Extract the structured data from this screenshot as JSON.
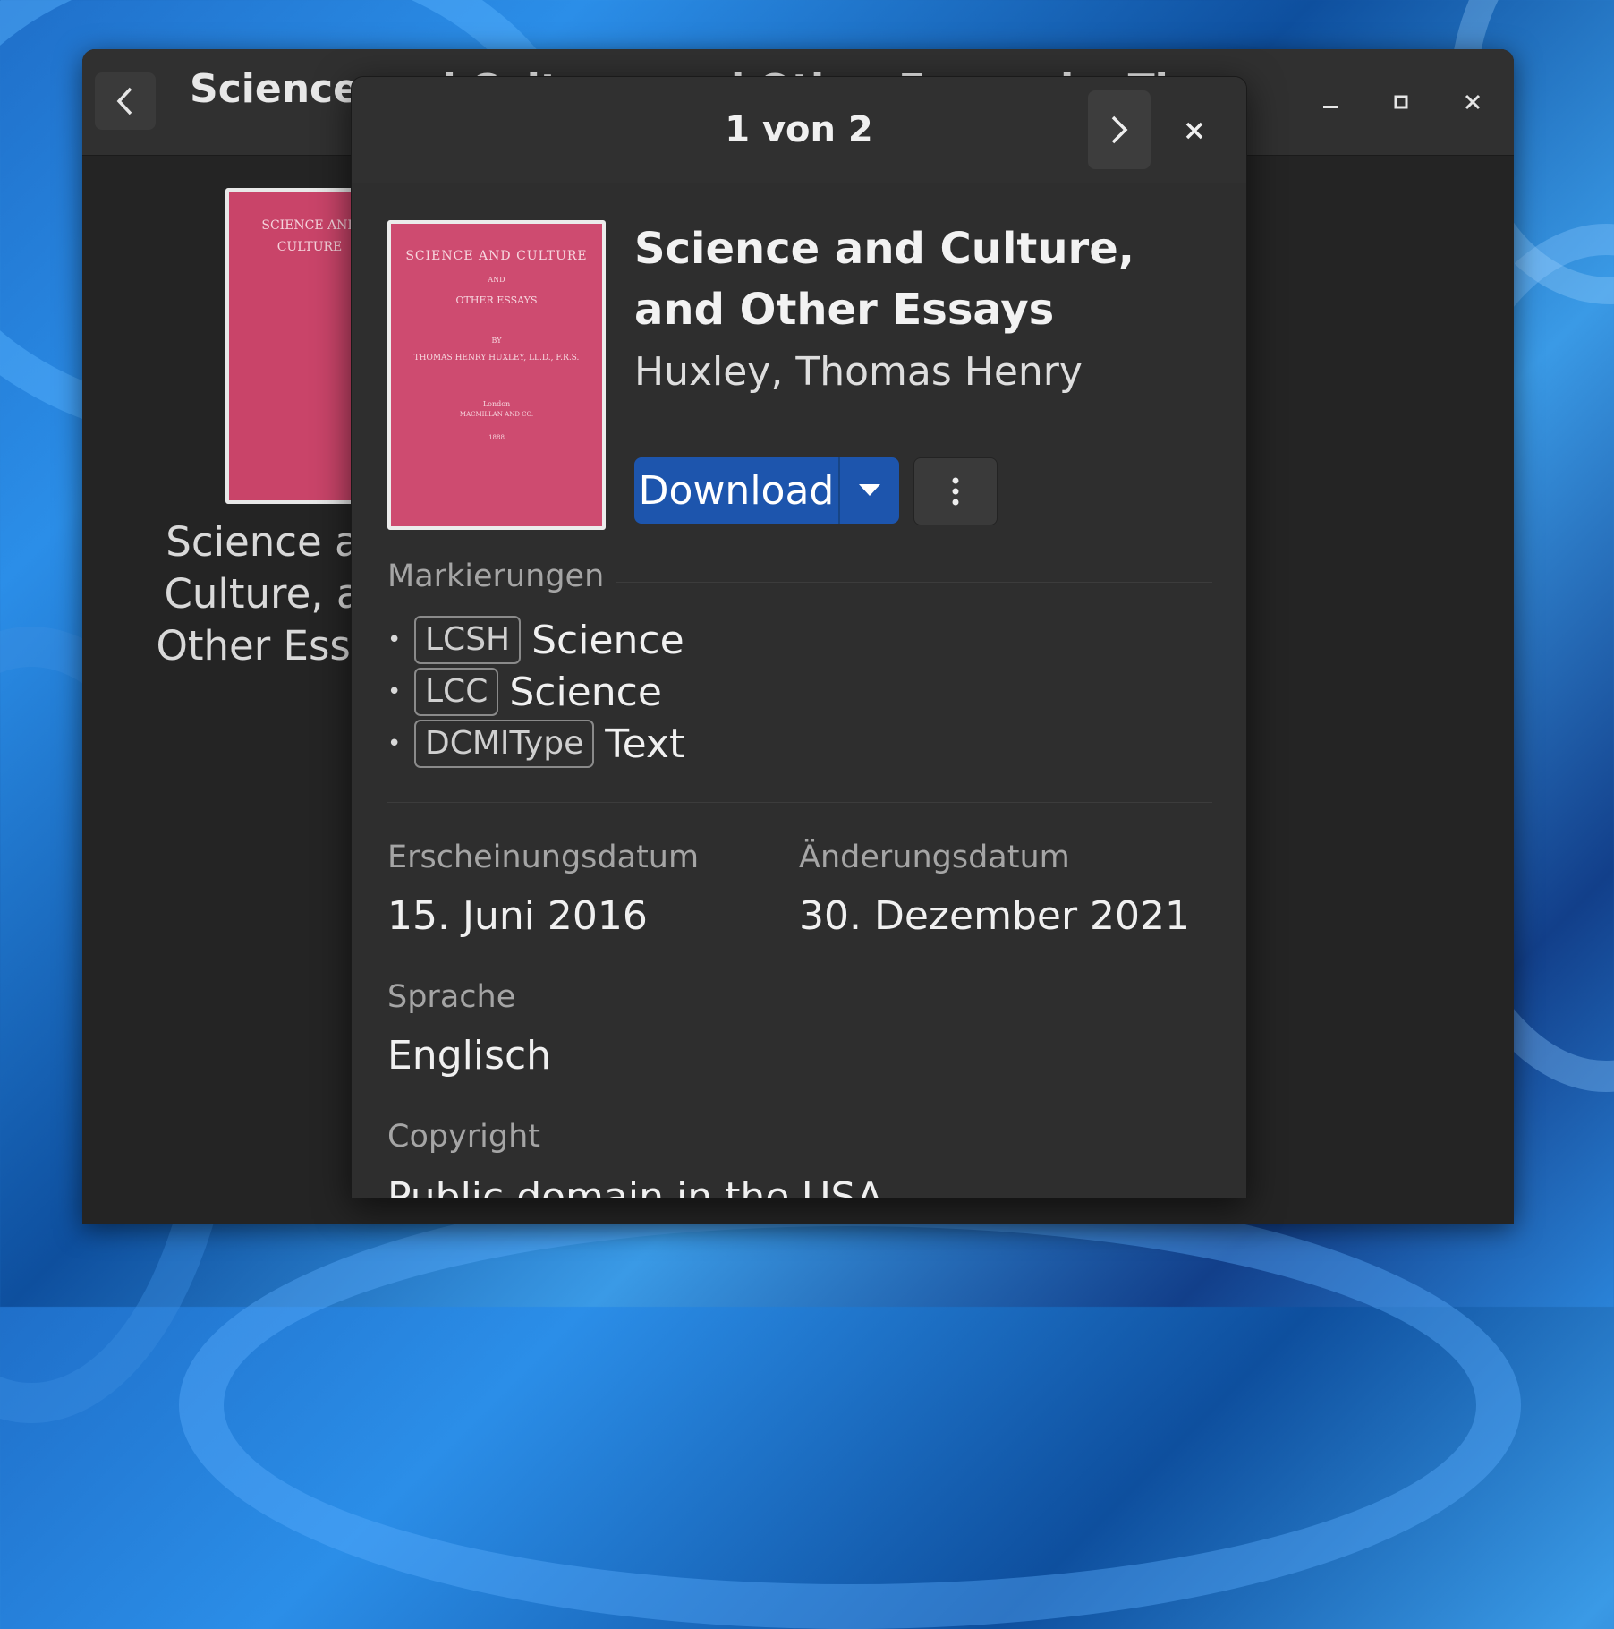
{
  "main_window": {
    "title": "Science and Culture, and Other Essays by The",
    "background_card_title": "Science and Culture, and Other Essays"
  },
  "dialog": {
    "title": "1 von 2",
    "next_icon": "chevron-right-icon",
    "close_icon": "close-icon"
  },
  "book": {
    "title": "Science and Culture, and Other Essays",
    "author": "Huxley, Thomas Henry",
    "cover": {
      "line1": "SCIENCE AND CULTURE",
      "line2": "AND",
      "line3": "OTHER ESSAYS",
      "line4": "BY",
      "line5": "THOMAS HENRY HUXLEY, LL.D., F.R.S.",
      "line6": "London",
      "line7": "MACMILLAN AND CO.",
      "line8": "1888",
      "color": "#ce4b70"
    }
  },
  "actions": {
    "download_label": "Download",
    "accent": "#1d55ad"
  },
  "tags": {
    "section_label": "Markierungen",
    "items": [
      {
        "scheme": "LCSH",
        "value": "Science"
      },
      {
        "scheme": "LCC",
        "value": "Science"
      },
      {
        "scheme": "DCMIType",
        "value": "Text"
      }
    ]
  },
  "details": {
    "published_label": "Erscheinungsdatum",
    "published_value": "15. Juni 2016",
    "modified_label": "Änderungsdatum",
    "modified_value": "30. Dezember 2021",
    "language_label": "Sprache",
    "language_value": "Englisch",
    "copyright_label": "Copyright",
    "copyright_value": "Public domain in the USA."
  }
}
